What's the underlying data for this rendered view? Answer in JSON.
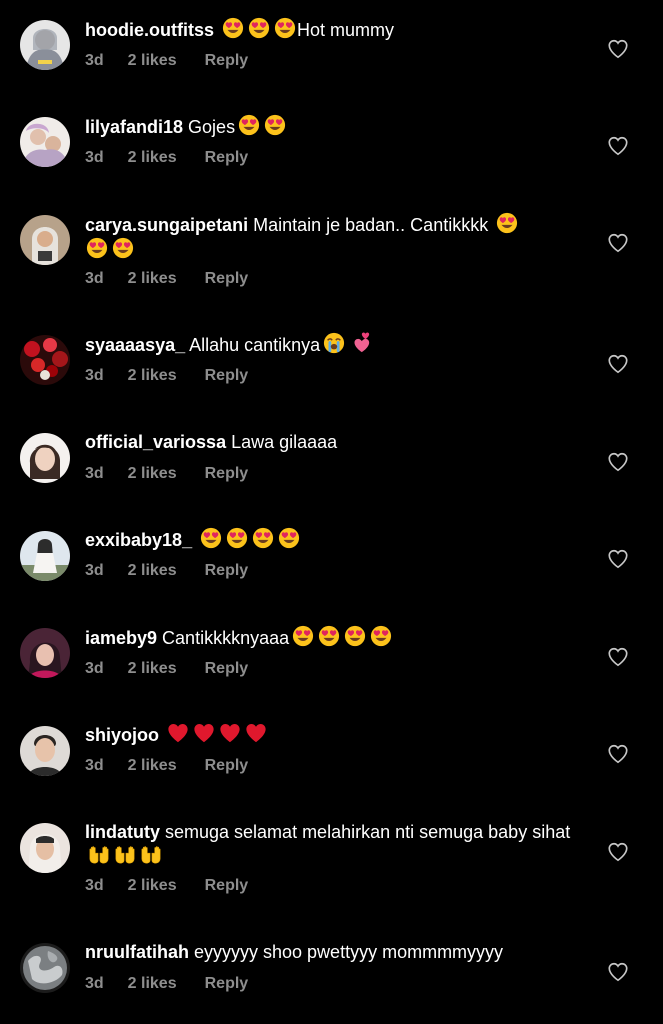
{
  "comments": [
    {
      "username": "hoodie.outfitss",
      "text_before": " ",
      "emojis": [
        "heart-eyes",
        "heart-eyes",
        "heart-eyes"
      ],
      "text_after": "Hot mummy",
      "time": "3d",
      "likes": "2 likes",
      "reply": "Reply",
      "avatar": "avatar-hoodie",
      "avatar_color": "#8a8f9a"
    },
    {
      "username": "lilyafandi18",
      "text_before": " Gojes",
      "emojis": [
        "heart-eyes",
        "heart-eyes"
      ],
      "text_after": "",
      "time": "3d",
      "likes": "2 likes",
      "reply": "Reply",
      "avatar": "avatar-lily",
      "avatar_color": "#d8c7c2"
    },
    {
      "username": "carya.sungaipetani",
      "text_before": " Maintain je badan.. Cantikkkk ",
      "emojis": [
        "heart-eyes",
        "heart-eyes",
        "heart-eyes"
      ],
      "text_after": "",
      "time": "3d",
      "likes": "2 likes",
      "reply": "Reply",
      "avatar": "avatar-carya",
      "avatar_color": "#c7a07a"
    },
    {
      "username": "syaaaasya_",
      "text_before": " Allahu cantiknya",
      "emojis": [
        "loudly-crying",
        "two-hearts"
      ],
      "text_after": "",
      "time": "3d",
      "likes": "2 likes",
      "reply": "Reply",
      "avatar": "avatar-syaaaasya",
      "avatar_color": "#a4161a"
    },
    {
      "username": "official_variossa",
      "text_before": " Lawa gilaaaa",
      "emojis": [],
      "text_after": "",
      "time": "3d",
      "likes": "2 likes",
      "reply": "Reply",
      "avatar": "avatar-variossa",
      "avatar_color": "#e9d6cb"
    },
    {
      "username": "exxibaby18_",
      "text_before": " ",
      "emojis": [
        "heart-eyes",
        "heart-eyes",
        "heart-eyes",
        "heart-eyes"
      ],
      "text_after": "",
      "time": "3d",
      "likes": "2 likes",
      "reply": "Reply",
      "avatar": "avatar-exxibaby",
      "avatar_color": "#c9d7e2"
    },
    {
      "username": "iameby9",
      "text_before": " Cantikkkknyaaa",
      "emojis": [
        "heart-eyes",
        "heart-eyes",
        "heart-eyes",
        "heart-eyes"
      ],
      "text_after": "",
      "time": "3d",
      "likes": "2 likes",
      "reply": "Reply",
      "avatar": "avatar-iameby",
      "avatar_color": "#7a3b52"
    },
    {
      "username": "shiyojoo",
      "text_before": " ",
      "emojis": [
        "red-heart",
        "red-heart",
        "red-heart",
        "red-heart"
      ],
      "text_after": "",
      "time": "3d",
      "likes": "2 likes",
      "reply": "Reply",
      "avatar": "avatar-shiyojoo",
      "avatar_color": "#d9d4d0"
    },
    {
      "username": "lindatuty",
      "text_before": " semuga selamat melahirkan nti semuga baby sihat",
      "emojis": [
        "palms-up",
        "palms-up",
        "palms-up"
      ],
      "text_after": "",
      "time": "3d",
      "likes": "2 likes",
      "reply": "Reply",
      "avatar": "avatar-lindatuty",
      "avatar_color": "#e6d8d0"
    },
    {
      "username": "nruulfatihah",
      "text_before": " eyyyyyy shoo pwettyyy mommmmyyyy",
      "emojis": [],
      "text_after": "",
      "time": "3d",
      "likes": "2 likes",
      "reply": "Reply",
      "avatar": "avatar-nruulfatihah",
      "avatar_color": "#6b6e70"
    }
  ],
  "colors": {
    "background": "#000000",
    "text": "#ffffff",
    "meta": "#8e8e8e",
    "heart_outline": "#c7c7c7"
  },
  "icons": {
    "like": "heart-outline-icon"
  }
}
